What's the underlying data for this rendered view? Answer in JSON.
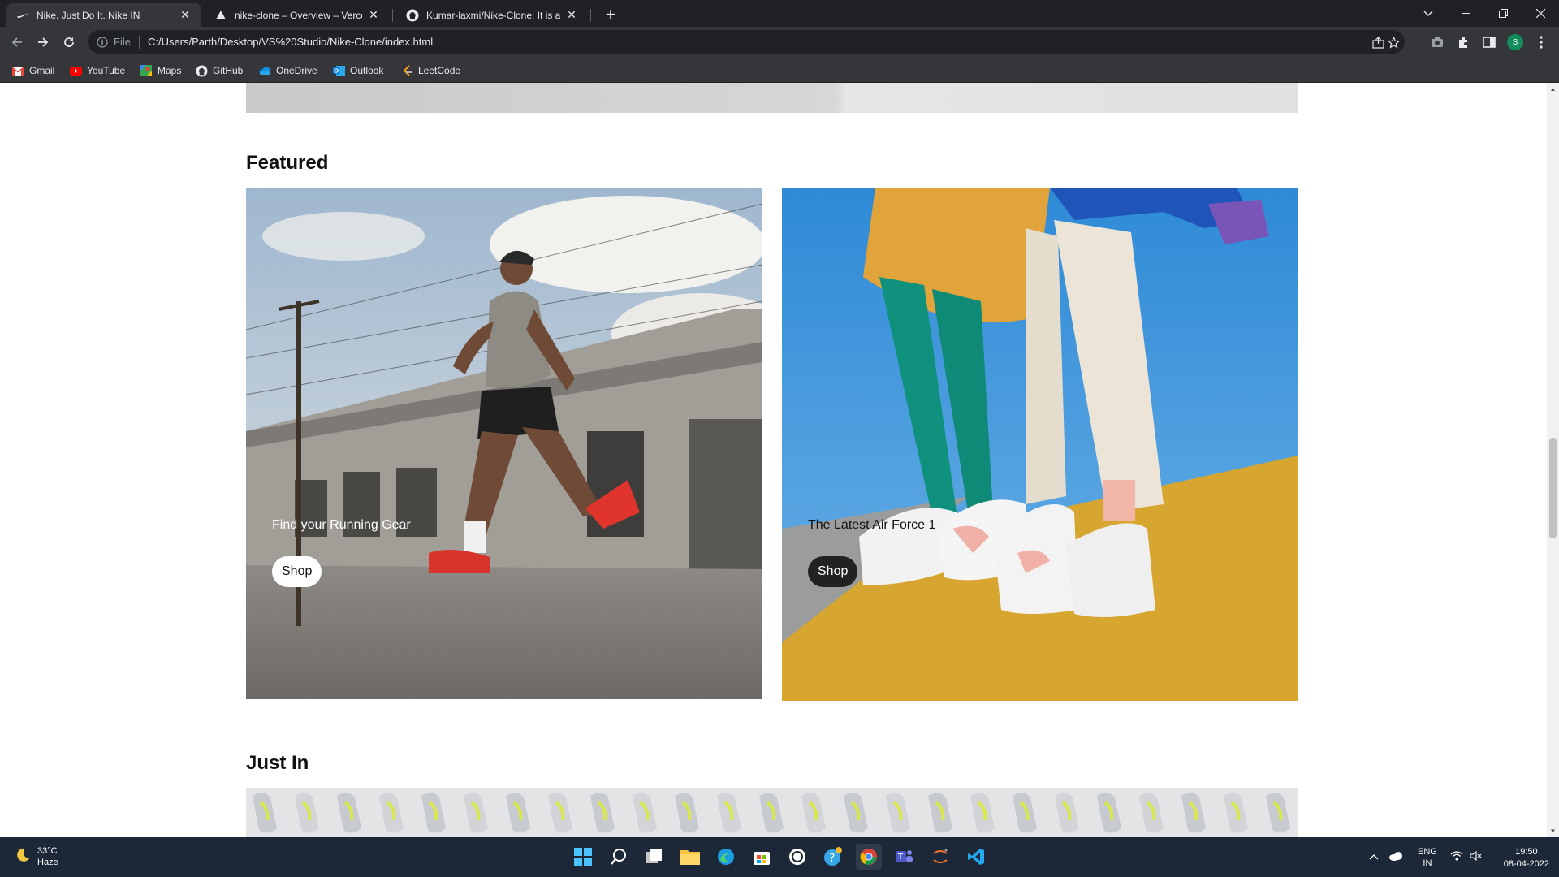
{
  "browser": {
    "tabs": [
      {
        "title": "Nike. Just Do It. Nike IN",
        "icon": "nike-swoosh-icon",
        "active": true
      },
      {
        "title": "nike-clone – Overview – Vercel",
        "icon": "vercel-icon",
        "active": false
      },
      {
        "title": "Kumar-laxmi/Nike-Clone: It is a C",
        "icon": "github-icon",
        "active": false
      }
    ],
    "address": {
      "scheme_label": "File",
      "url": "C:/Users/Parth/Desktop/VS%20Studio/Nike-Clone/index.html"
    },
    "profile_initial": "S",
    "bookmarks": [
      {
        "label": "Gmail",
        "icon": "gmail-icon"
      },
      {
        "label": "YouTube",
        "icon": "youtube-icon"
      },
      {
        "label": "Maps",
        "icon": "maps-icon"
      },
      {
        "label": "GitHub",
        "icon": "github-icon"
      },
      {
        "label": "OneDrive",
        "icon": "onedrive-icon"
      },
      {
        "label": "Outlook",
        "icon": "outlook-icon"
      },
      {
        "label": "LeetCode",
        "icon": "leetcode-icon"
      }
    ]
  },
  "page": {
    "featured": {
      "title": "Featured",
      "cards": [
        {
          "caption": "Find your Running Gear",
          "button": "Shop",
          "scene": "runner-photo",
          "button_style": "light"
        },
        {
          "caption": "The Latest Air Force 1",
          "button": "Shop",
          "scene": "air-force-photo",
          "button_style": "dark"
        }
      ]
    },
    "just_in": {
      "title": "Just In"
    }
  },
  "taskbar": {
    "weather": {
      "temp": "33°C",
      "condition": "Haze",
      "icon": "moon-icon"
    },
    "apps": [
      "windows-start-icon",
      "search-icon",
      "task-view-icon",
      "file-explorer-icon",
      "edge-icon",
      "microsoft-store-icon",
      "chatgpt-icon",
      "paint-icon",
      "chrome-icon",
      "teams-icon",
      "jupyter-icon",
      "vscode-icon"
    ],
    "language": {
      "line1": "ENG",
      "line2": "IN"
    },
    "time": "19:50",
    "date": "08-04-2022"
  },
  "colors": {
    "chrome_dark": "#202124",
    "chrome_toolbar": "#35363a",
    "taskbar": "#1c2838",
    "profile": "#128c5d"
  }
}
